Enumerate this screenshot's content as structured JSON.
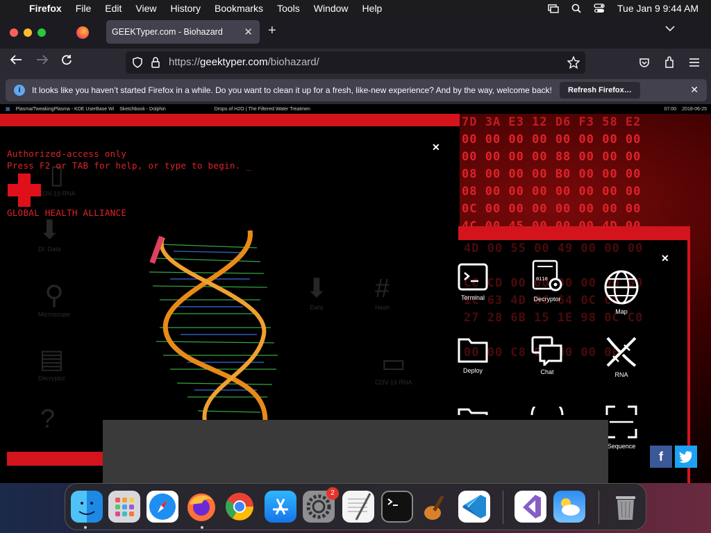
{
  "menubar": {
    "app_name": "Firefox",
    "items": [
      "File",
      "Edit",
      "View",
      "History",
      "Bookmarks",
      "Tools",
      "Window",
      "Help"
    ],
    "datetime": "Tue Jan 9  9:44 AM"
  },
  "tab": {
    "title": "GEEKTyper.com - Biohazard"
  },
  "url": {
    "prefix": "https://",
    "domain": "geektyper.com",
    "path": "/biohazard/"
  },
  "notification": {
    "message": "It looks like you haven’t started Firefox in a while. Do you want to clean it up for a fresh, like-new experience? And by the way, welcome back!",
    "button": "Refresh Firefox…"
  },
  "kde_taskbar": {
    "items": [
      "Plasma/TweakingPlasma - KDE UserBase Wi",
      "Sketchbook - Dolphin",
      "Drops of H2O ( The Filtered Water Treatmen"
    ],
    "clock": "07:00",
    "date": "2018-06-25"
  },
  "terminal": {
    "line1": "Authorized-access only",
    "line2": "Press F2 or TAB for help, or type to begin. _",
    "org": "GLOBAL HEALTH ALLIANCE"
  },
  "ghost_desktop": [
    {
      "label": "COV-19 RNA"
    },
    {
      "label": "Dl. Data"
    },
    {
      "label": "Microscope"
    },
    {
      "label": "Decryptor"
    },
    {
      "label": "Data"
    },
    {
      "label": "Hash"
    },
    {
      "label": "COV-19 RNA"
    }
  ],
  "hex_rows": [
    "7D 3A E3 12 D6 F3 58 E2",
    "00 00 00 00 00 00 00 00",
    "00 00 00 00 88 00 00 00",
    "08 00 00 00 B0 00 00 00",
    "08 00 00 00 00 00 00 00",
    "0C 00 00 00 00 00 00 00",
    "4C 00 45 00 00 00 4D 00"
  ],
  "hex_rows_behind": [
    "4D 00 55 00 49 00 00 00",
    "CC CD 00 00 00 00 00 00",
    "1C 63 4D 6C 64 0C C8",
    "27 28 6B 15 1E 98 0C C0",
    "00 00 C8 00 00 00 00"
  ],
  "apps": [
    {
      "label": "Terminal",
      "icon": "terminal-icon"
    },
    {
      "label": "Decryptor",
      "icon": "decryptor-icon"
    },
    {
      "label": "Map",
      "icon": "globe-icon"
    },
    {
      "label": "Deploy",
      "icon": "folder-icon"
    },
    {
      "label": "Chat",
      "icon": "chat-icon"
    },
    {
      "label": "RNA",
      "icon": "dna-icon"
    },
    {
      "label": "Sequence",
      "icon": "scan-frame-icon"
    }
  ],
  "social": {
    "facebook": "f",
    "twitter_color": "#1da1f2",
    "facebook_color": "#3b5998"
  },
  "dock": {
    "badge_count": "2",
    "apps": [
      "Finder",
      "Launchpad",
      "Safari",
      "Firefox",
      "Chrome",
      "App Store",
      "System Settings",
      "TextEdit",
      "Terminal",
      "GarageBand",
      "Visual Studio Code",
      "Visual Studio",
      "Weather",
      "Trash"
    ]
  },
  "colors": {
    "accent_red": "#d4141c",
    "terminal_red": "#e0222a"
  }
}
